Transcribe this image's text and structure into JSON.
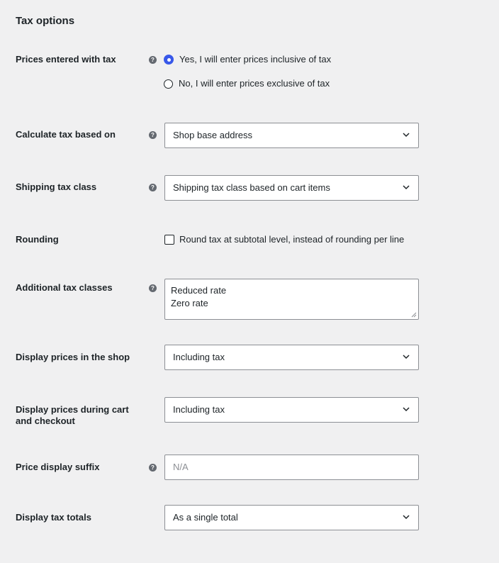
{
  "section": {
    "title": "Tax options"
  },
  "help_glyph": "?",
  "prices_entered": {
    "label": "Prices entered with tax",
    "options": [
      {
        "label": "Yes, I will enter prices inclusive of tax",
        "checked": true
      },
      {
        "label": "No, I will enter prices exclusive of tax",
        "checked": false
      }
    ]
  },
  "calculate_based_on": {
    "label": "Calculate tax based on",
    "value": "Shop base address"
  },
  "shipping_tax_class": {
    "label": "Shipping tax class",
    "value": "Shipping tax class based on cart items"
  },
  "rounding": {
    "label": "Rounding",
    "checkbox_label": "Round tax at subtotal level, instead of rounding per line",
    "checked": false
  },
  "additional_classes": {
    "label": "Additional tax classes",
    "lines": [
      "Reduced rate",
      "Zero rate"
    ]
  },
  "display_shop": {
    "label": "Display prices in the shop",
    "value": "Including tax"
  },
  "display_cart": {
    "label": "Display prices during cart and checkout",
    "value": "Including tax"
  },
  "price_suffix": {
    "label": "Price display suffix",
    "placeholder": "N/A"
  },
  "display_totals": {
    "label": "Display tax totals",
    "value": "As a single total"
  },
  "colors": {
    "accent": "#3858e9",
    "background": "#f0f0f1",
    "border": "#8c8f94",
    "text": "#1d2327"
  }
}
